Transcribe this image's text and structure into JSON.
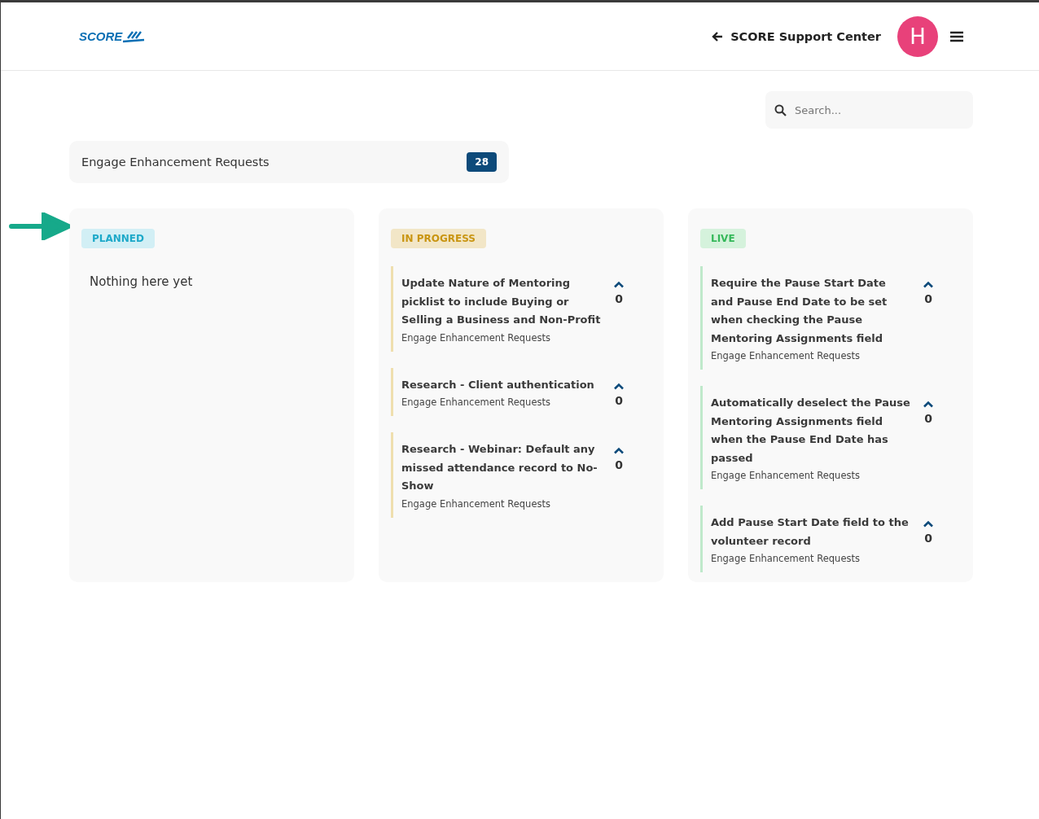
{
  "header": {
    "logo": "SCORE",
    "back_link": "SCORE Support Center",
    "avatar": "H"
  },
  "search": {
    "placeholder": "Search..."
  },
  "board": {
    "title": "Engage Enhancement Requests",
    "count": "28"
  },
  "columns": [
    {
      "kind": "planned",
      "label": "PLANNED",
      "empty_text": "Nothing here yet"
    },
    {
      "kind": "in_progress",
      "label": "IN PROGRESS",
      "items": [
        {
          "title": "Update Nature of Mentoring picklist to include Buying or Selling a Business and Non-Profit",
          "board": "Engage Enhancement Requests",
          "votes": "0"
        },
        {
          "title": "Research - Client authentication",
          "board": "Engage Enhancement Requests",
          "votes": "0"
        },
        {
          "title": "Research - Webinar: Default any missed attendance record to No-Show",
          "board": "Engage Enhancement Requests",
          "votes": "0"
        }
      ]
    },
    {
      "kind": "live",
      "label": "LIVE",
      "items": [
        {
          "title": "Require the Pause Start Date and Pause End Date to be set when checking the Pause Mentoring Assignments field",
          "board": "Engage Enhancement Requests",
          "votes": "0"
        },
        {
          "title": "Automatically deselect the Pause Mentoring Assignments field when the Pause End Date has passed",
          "board": "Engage Enhancement Requests",
          "votes": "0"
        },
        {
          "title": "Add Pause Start Date field to the volunteer record",
          "board": "Engage Enhancement Requests",
          "votes": "0"
        }
      ]
    }
  ]
}
